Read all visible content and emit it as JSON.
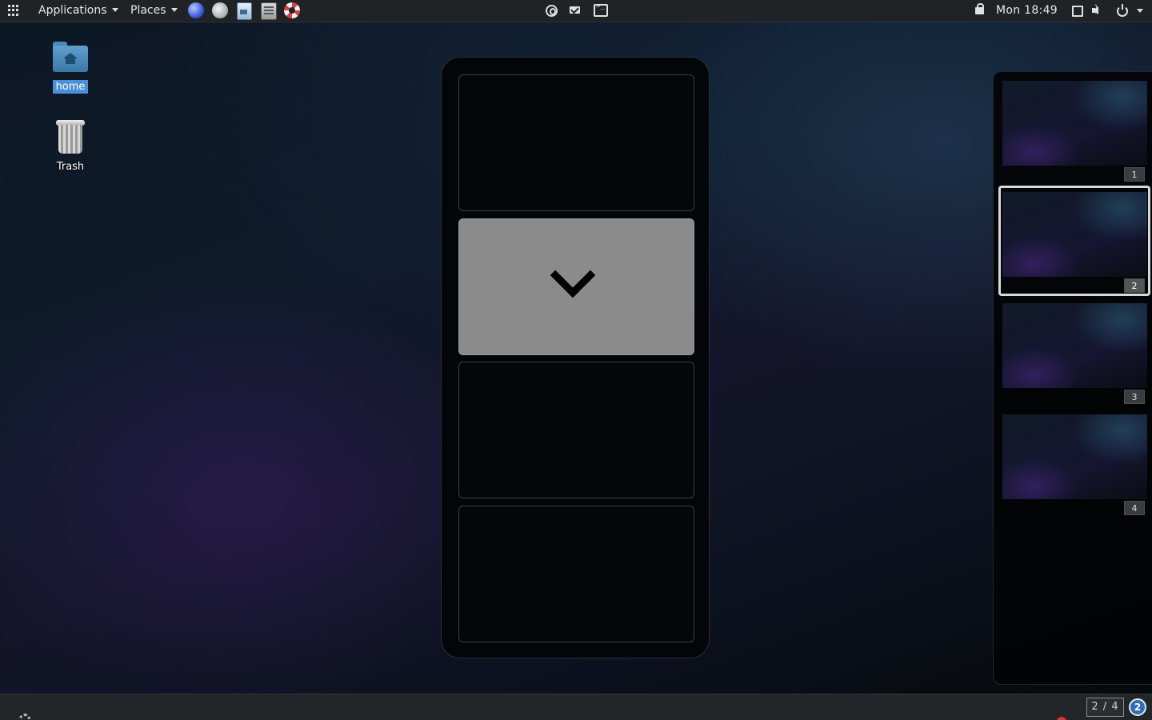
{
  "top_panel": {
    "applications_label": "Applications",
    "places_label": "Places",
    "clock": "Mon 18:49",
    "launchers": [
      "web-browser-icon",
      "help-icon",
      "text-editor-icon",
      "file-manager-icon",
      "lifebuoy-icon"
    ],
    "tray": [
      "hexchat-icon",
      "mail-icon",
      "terminal-icon"
    ]
  },
  "desktop": {
    "icons": [
      {
        "label": "home",
        "icon": "home-folder-icon",
        "selected": true
      },
      {
        "label": "Trash",
        "icon": "trash-icon",
        "selected": false
      }
    ]
  },
  "workspace_switcher": {
    "count": 4,
    "active_index": 2,
    "direction_icon": "chevron-down-icon"
  },
  "workspace_thumbnails": [
    {
      "number": "1"
    },
    {
      "number": "2",
      "active": true
    },
    {
      "number": "3"
    },
    {
      "number": "4"
    }
  ],
  "bottom_panel": {
    "workspace_indicator": "2 / 4",
    "notification_count": "2"
  }
}
